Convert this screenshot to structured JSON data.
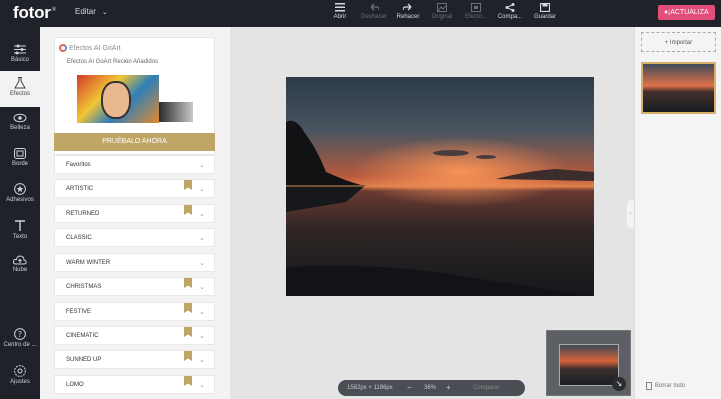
{
  "app": {
    "logo": "fotor",
    "logo_mark": "®",
    "edit_menu": "Editar"
  },
  "toolbar": {
    "items": [
      {
        "label": "Abrir",
        "icon": "menu-icon",
        "enabled": true
      },
      {
        "label": "Deshacer",
        "icon": "undo-icon",
        "enabled": false
      },
      {
        "label": "Rehacer",
        "icon": "redo-icon",
        "enabled": true
      },
      {
        "label": "Original",
        "icon": "original-icon",
        "enabled": false
      },
      {
        "label": "Efecto...",
        "icon": "effect-icon",
        "enabled": false
      },
      {
        "label": "Compa...",
        "icon": "share-icon",
        "enabled": true
      },
      {
        "label": "Guardar",
        "icon": "save-icon",
        "enabled": true
      }
    ],
    "upgrade": "¡ACTUALIZA"
  },
  "sidebar": {
    "items": [
      {
        "label": "Básico",
        "icon": "sliders-icon"
      },
      {
        "label": "Efectos",
        "icon": "flask-icon",
        "active": true
      },
      {
        "label": "Belleza",
        "icon": "eye-icon"
      },
      {
        "label": "Borde",
        "icon": "frame-icon"
      },
      {
        "label": "Adhesivos",
        "icon": "sticker-icon"
      },
      {
        "label": "Texto",
        "icon": "text-icon"
      },
      {
        "label": "Nube",
        "icon": "cloud-icon"
      },
      {
        "label": "Centro de ...",
        "icon": "help-icon"
      },
      {
        "label": "Ajustes",
        "icon": "settings-icon"
      }
    ]
  },
  "effects": {
    "promo_title": "Efectos AI GoArt",
    "promo_subtitle": "Efectos AI GoArt Recién Añadidos",
    "try_button": "PRUÉBALO AHORA",
    "categories": [
      {
        "label": "Favoritos",
        "premium": false
      },
      {
        "label": "ARTISTIC",
        "premium": true
      },
      {
        "label": "RETURNED",
        "premium": true
      },
      {
        "label": "CLASSIC",
        "premium": false
      },
      {
        "label": "WARM WINTER",
        "premium": false
      },
      {
        "label": "CHRISTMAS",
        "premium": true
      },
      {
        "label": "FESTIVE",
        "premium": true
      },
      {
        "label": "CINEMATIC",
        "premium": true
      },
      {
        "label": "SUNNED UP",
        "premium": true
      },
      {
        "label": "LOMO",
        "premium": true
      }
    ]
  },
  "canvas": {
    "dimensions": "1582px × 1186px",
    "zoom": "36%",
    "zoom_out": "−",
    "zoom_in": "+",
    "compare": "Comparar"
  },
  "right_panel": {
    "import": "+ Importar",
    "clear_all": "Borrar todo"
  },
  "colors": {
    "accent_gold": "#bfa566",
    "upgrade": "#e24d7a",
    "dark": "#1f2229"
  }
}
